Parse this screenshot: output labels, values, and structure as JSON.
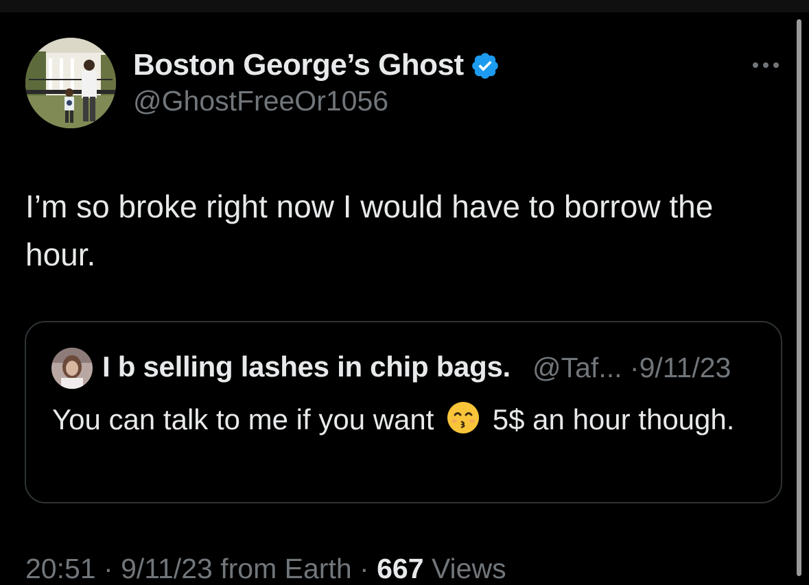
{
  "tweet": {
    "author_name": "Boston George’s Ghost",
    "handle": "@GhostFreeOr1056",
    "text": "I’m so broke right now I would have to borrow the hour.",
    "more_icon": "more-horizontal-icon",
    "verified_icon": "verified-badge-icon",
    "verified_color": "#1d9bf0"
  },
  "quoted_tweet": {
    "author_name": "I b selling lashes in chip bags.",
    "handle": "@Taf...",
    "separator": "·",
    "date": "9/11/23",
    "text_before_emoji": "You can talk to me if you want",
    "emoji_name": "kissing-face-with-smiling-eyes-emoji",
    "text_after_emoji": "5$ an hour though."
  },
  "footer": {
    "time": "20:51",
    "sep1": "·",
    "date": "9/11/23",
    "source": "from Earth",
    "sep2": "·",
    "views_count": "667",
    "views_label": "Views"
  },
  "colors": {
    "background": "#000000",
    "primary_text": "#e7e9ea",
    "secondary_text": "#71767b",
    "border": "#2f3336"
  }
}
